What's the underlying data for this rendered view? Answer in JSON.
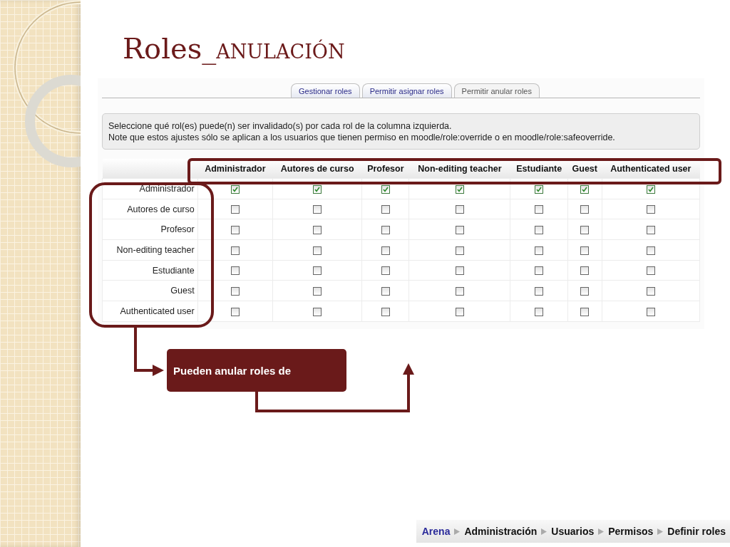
{
  "title": {
    "main": "Roles_",
    "sub": "ANULACIÓN"
  },
  "tabs": [
    {
      "label": "Gestionar roles",
      "selected": false
    },
    {
      "label": "Permitir asignar roles",
      "selected": false
    },
    {
      "label": "Permitir anular roles",
      "selected": true
    }
  ],
  "info": [
    "Seleccione qué rol(es) puede(n) ser invalidado(s) por cada rol de la columna izquierda.",
    "Note que estos ajustes sólo se aplican a los usuarios que tienen permiso en moodle/role:override o en moodle/role:safeoverride."
  ],
  "table": {
    "columns": [
      "Administrador",
      "Autores de curso",
      "Profesor",
      "Non-editing teacher",
      "Estudiante",
      "Guest",
      "Authenticated user"
    ],
    "rows": [
      {
        "label": "Administrador",
        "checks": [
          true,
          true,
          true,
          true,
          true,
          true,
          true
        ]
      },
      {
        "label": "Autores de curso",
        "checks": [
          false,
          false,
          false,
          false,
          false,
          false,
          false
        ]
      },
      {
        "label": "Profesor",
        "checks": [
          false,
          false,
          false,
          false,
          false,
          false,
          false
        ]
      },
      {
        "label": "Non-editing teacher",
        "checks": [
          false,
          false,
          false,
          false,
          false,
          false,
          false
        ]
      },
      {
        "label": "Estudiante",
        "checks": [
          false,
          false,
          false,
          false,
          false,
          false,
          false
        ]
      },
      {
        "label": "Guest",
        "checks": [
          false,
          false,
          false,
          false,
          false,
          false,
          false
        ]
      },
      {
        "label": "Authenticated user",
        "checks": [
          false,
          false,
          false,
          false,
          false,
          false,
          false
        ]
      }
    ]
  },
  "callout": {
    "text": "Pueden anular roles de"
  },
  "breadcrumb": [
    {
      "label": "Arena",
      "kind": "link"
    },
    {
      "label": "Administración",
      "kind": "text"
    },
    {
      "label": "Usuarios",
      "kind": "text"
    },
    {
      "label": "Permisos",
      "kind": "text"
    },
    {
      "label": "Definir roles",
      "kind": "text"
    }
  ]
}
